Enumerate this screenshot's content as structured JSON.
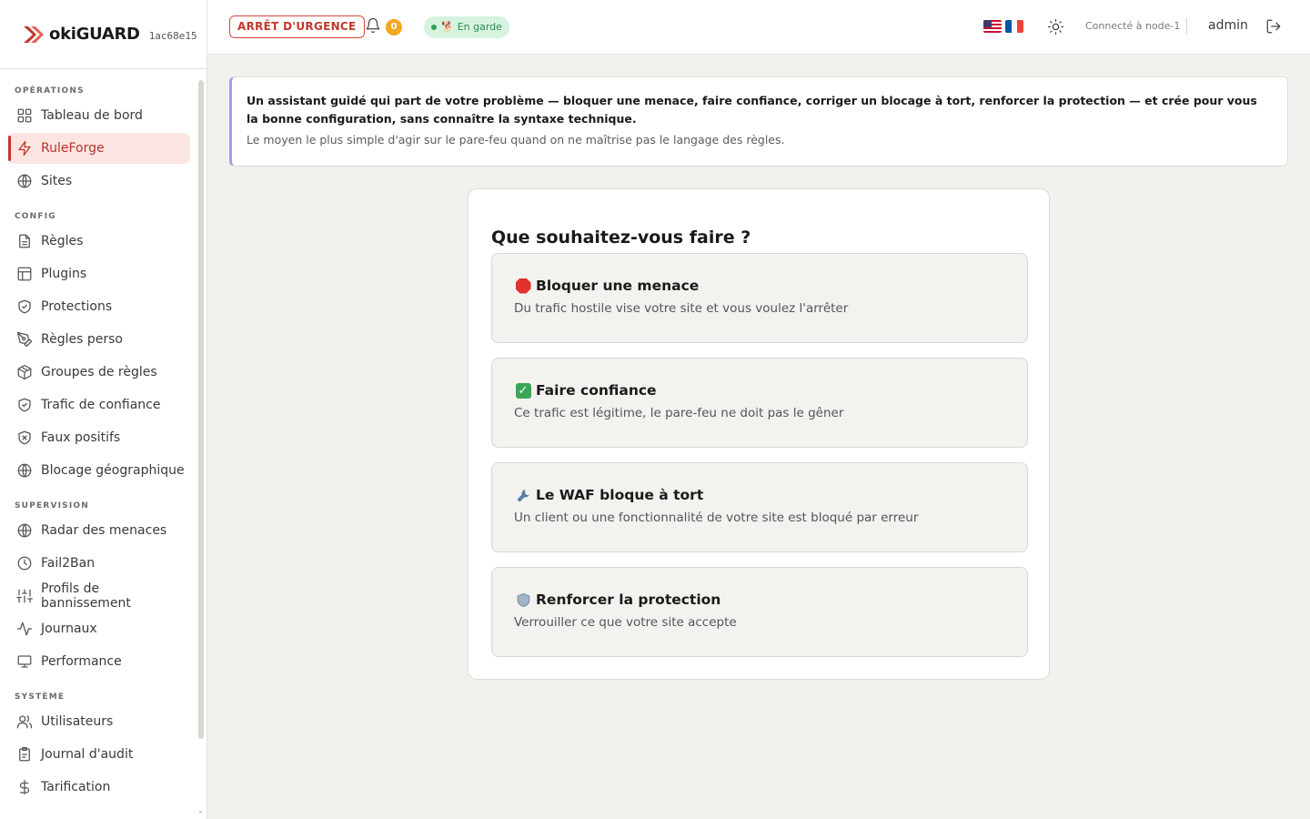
{
  "brand": {
    "name": "okiGUARD",
    "hash": "1ac68e15"
  },
  "sidebar": {
    "sections": [
      {
        "label": "OPÉRATIONS",
        "items": [
          {
            "label": "Tableau de bord",
            "icon": "grid-icon"
          },
          {
            "label": "RuleForge",
            "icon": "bolt-icon",
            "active": true
          },
          {
            "label": "Sites",
            "icon": "globe-icon"
          }
        ]
      },
      {
        "label": "CONFIG",
        "items": [
          {
            "label": "Règles",
            "icon": "file-icon"
          },
          {
            "label": "Plugins",
            "icon": "layout-icon"
          },
          {
            "label": "Protections",
            "icon": "shield-check-icon"
          },
          {
            "label": "Règles perso",
            "icon": "pen-tool-icon"
          },
          {
            "label": "Groupes de règles",
            "icon": "package-icon"
          },
          {
            "label": "Trafic de confiance",
            "icon": "shield-check-icon"
          },
          {
            "label": "Faux positifs",
            "icon": "shield-x-icon"
          },
          {
            "label": "Blocage géographique",
            "icon": "globe-icon"
          }
        ]
      },
      {
        "label": "SUPERVISION",
        "items": [
          {
            "label": "Radar des menaces",
            "icon": "globe-icon"
          },
          {
            "label": "Fail2Ban",
            "icon": "clock-icon"
          },
          {
            "label": "Profils de bannissement",
            "icon": "sliders-icon"
          },
          {
            "label": "Journaux",
            "icon": "activity-icon"
          },
          {
            "label": "Performance",
            "icon": "monitor-icon"
          }
        ]
      },
      {
        "label": "SYSTÈME",
        "items": [
          {
            "label": "Utilisateurs",
            "icon": "users-icon"
          },
          {
            "label": "Journal d'audit",
            "icon": "clipboard-icon"
          },
          {
            "label": "Tarification",
            "icon": "dollar-icon"
          }
        ]
      }
    ]
  },
  "topbar": {
    "emergency_label": "ARRÊT D'URGENCE",
    "notification_count": "0",
    "status_label": "En garde",
    "connected_label": "Connecté à node-1",
    "user_label": "admin"
  },
  "banner": {
    "main": "Un assistant guidé qui part de votre problème — bloquer une menace, faire confiance, corriger un blocage à tort, renforcer la protection — et crée pour vous la bonne configuration, sans connaître la syntaxe technique.",
    "sub": "Le moyen le plus simple d'agir sur le pare-feu quand on ne maîtrise pas le langage des règles."
  },
  "wizard": {
    "title": "Que souhaitez-vous faire ?",
    "options": [
      {
        "title": "Bloquer une menace",
        "desc": "Du trafic hostile vise votre site et vous voulez l'arrêter",
        "icon": "stop-sign-icon"
      },
      {
        "title": "Faire confiance",
        "desc": "Ce trafic est légitime, le pare-feu ne doit pas le gêner",
        "icon": "check-mark-icon"
      },
      {
        "title": "Le WAF bloque à tort",
        "desc": "Un client ou une fonctionnalité de votre site est bloqué par erreur",
        "icon": "wrench-icon"
      },
      {
        "title": "Renforcer la protection",
        "desc": "Verrouiller ce que votre site accepte",
        "icon": "shield-icon"
      }
    ]
  },
  "colors": {
    "accent": "#c0392b",
    "active_bg": "#fbe5e3",
    "status_green": "#2f8a4f",
    "banner_border": "#a99be0"
  }
}
